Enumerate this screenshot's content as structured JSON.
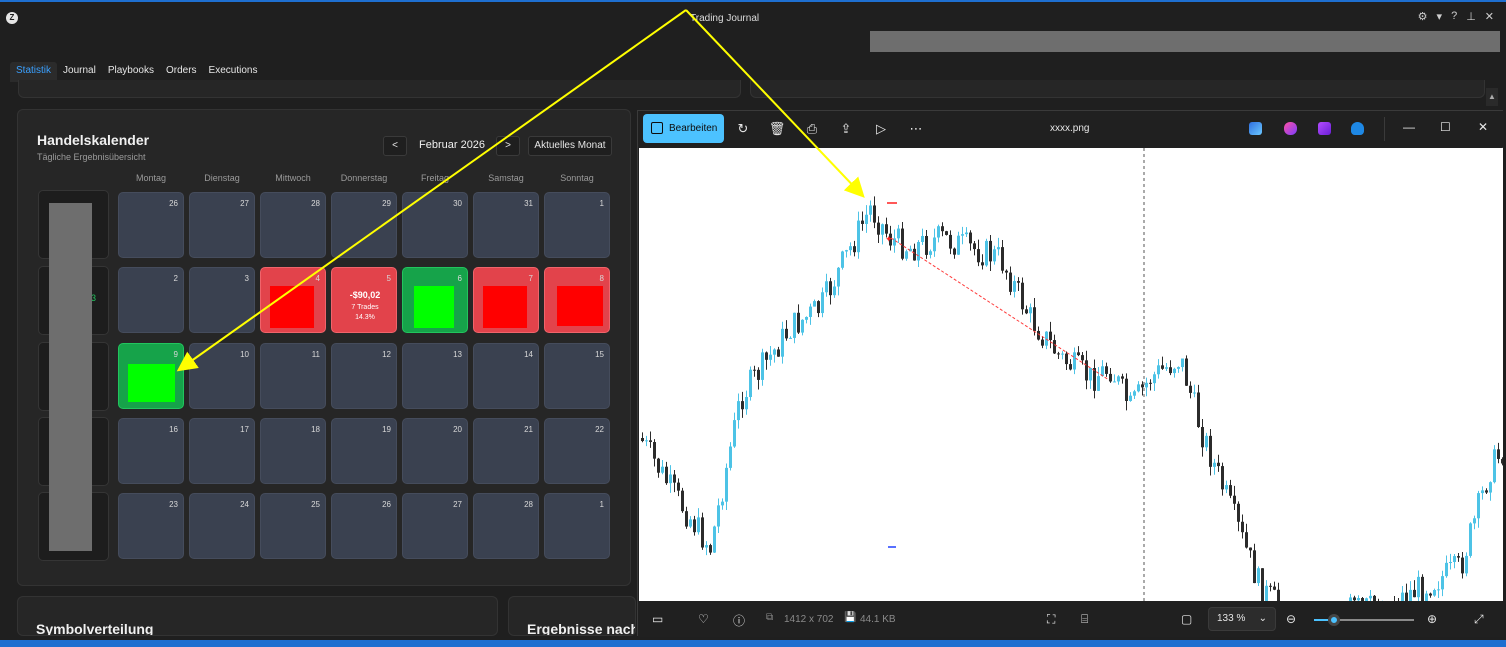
{
  "window": {
    "title": "Trading Journal"
  },
  "tabs": [
    {
      "label": "Statistik",
      "active": true
    },
    {
      "label": "Journal",
      "active": false
    },
    {
      "label": "Playbooks",
      "active": false
    },
    {
      "label": "Orders",
      "active": false
    },
    {
      "label": "Executions",
      "active": false
    }
  ],
  "calendar": {
    "title": "Handelskalender",
    "subtitle": "Tägliche Ergebnisübersicht",
    "prev_label": "<",
    "next_label": ">",
    "month_label": "Februar 2026",
    "today_label": "Aktuelles Monat",
    "weekdays": [
      "Montag",
      "Dienstag",
      "Mittwoch",
      "Donnerstag",
      "Freitag",
      "Samstag",
      "Sonntag"
    ],
    "week_green_value": "3",
    "weeks": [
      [
        {
          "day": "26"
        },
        {
          "day": "27"
        },
        {
          "day": "28"
        },
        {
          "day": "29"
        },
        {
          "day": "30"
        },
        {
          "day": "31"
        },
        {
          "day": "1"
        }
      ],
      [
        {
          "day": "2"
        },
        {
          "day": "3"
        },
        {
          "day": "4",
          "state": "loss"
        },
        {
          "day": "5",
          "state": "loss",
          "pnl": "-$90,02",
          "trades": "7 Trades",
          "pct": "14.3%"
        },
        {
          "day": "6",
          "state": "win"
        },
        {
          "day": "7",
          "state": "loss"
        },
        {
          "day": "8",
          "state": "loss"
        }
      ],
      [
        {
          "day": "9",
          "state": "win"
        },
        {
          "day": "10"
        },
        {
          "day": "11"
        },
        {
          "day": "12"
        },
        {
          "day": "13"
        },
        {
          "day": "14"
        },
        {
          "day": "15"
        }
      ],
      [
        {
          "day": "16"
        },
        {
          "day": "17"
        },
        {
          "day": "18"
        },
        {
          "day": "19"
        },
        {
          "day": "20"
        },
        {
          "day": "21"
        },
        {
          "day": "22"
        }
      ],
      [
        {
          "day": "23"
        },
        {
          "day": "24"
        },
        {
          "day": "25"
        },
        {
          "day": "26"
        },
        {
          "day": "27"
        },
        {
          "day": "28"
        },
        {
          "day": "1"
        }
      ]
    ]
  },
  "bottom_cards": {
    "left_title": "Symbolverteilung",
    "right_title": "Ergebnisse nach"
  },
  "viewer": {
    "edit_label": "Bearbeiten",
    "file_name": "xxxx.png",
    "dimensions": "1412 x 702",
    "file_size": "44.1 KB",
    "zoom_label": "133 %",
    "zoom_level": 0.2
  },
  "colors": {
    "accent": "#4cc2ff",
    "tab_active": "#3aa0ff",
    "loss_cell": "#e2434b",
    "win_cell": "#16a34a",
    "annotation_arrow": "#ffff00",
    "candle_up": "#4dc3e6",
    "candle_down": "#2b2b2b"
  }
}
